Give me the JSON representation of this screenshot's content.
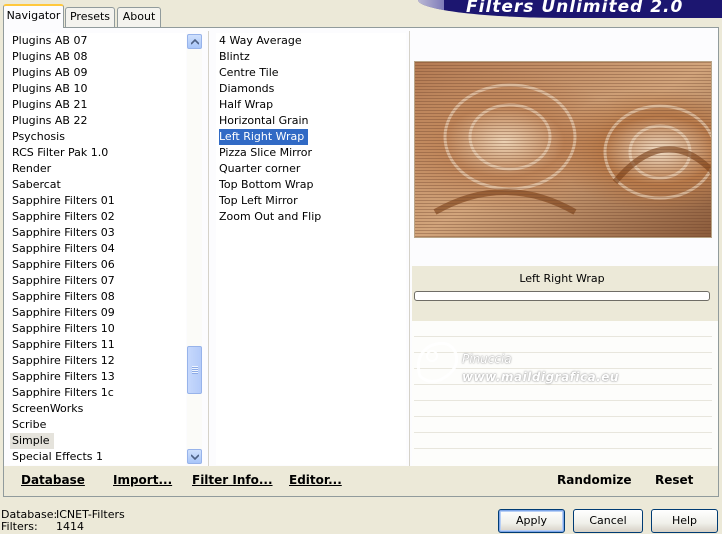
{
  "window": {
    "title": "Filters Unlimited 2.0"
  },
  "tabs": [
    {
      "label": "Navigator",
      "active": true
    },
    {
      "label": "Presets",
      "active": false
    },
    {
      "label": "About",
      "active": false
    }
  ],
  "categories": {
    "items": [
      "Plugins AB 07",
      "Plugins AB 08",
      "Plugins AB 09",
      "Plugins AB 10",
      "Plugins AB 21",
      "Plugins AB 22",
      "Psychosis",
      "RCS Filter Pak 1.0",
      "Render",
      "Sabercat",
      "Sapphire Filters 01",
      "Sapphire Filters 02",
      "Sapphire Filters 03",
      "Sapphire Filters 04",
      "Sapphire Filters 06",
      "Sapphire Filters 07",
      "Sapphire Filters 08",
      "Sapphire Filters 09",
      "Sapphire Filters 10",
      "Sapphire Filters 11",
      "Sapphire Filters 12",
      "Sapphire Filters 13",
      "Sapphire Filters 1c",
      "ScreenWorks",
      "Scribe",
      "Simple",
      "Special Effects 1"
    ],
    "selected": "Simple"
  },
  "filters": {
    "items": [
      "4 Way Average",
      "Blintz",
      "Centre Tile",
      "Diamonds",
      "Half Wrap",
      "Horizontal Grain",
      "Left Right Wrap",
      "Pizza Slice Mirror",
      "Quarter corner",
      "Top Bottom Wrap",
      "Top Left Mirror",
      "Zoom Out and Flip"
    ],
    "selected": "Left Right Wrap"
  },
  "preview": {
    "filter_name": "Left Right Wrap"
  },
  "watermark": {
    "name": "Pinuccia",
    "url": "www.maildigrafica.eu"
  },
  "actions": {
    "database": "Database",
    "import": "Import...",
    "filter_info": "Filter Info...",
    "editor": "Editor...",
    "randomize": "Randomize",
    "reset": "Reset"
  },
  "status": {
    "database_label": "Database:",
    "database_value": "ICNET-Filters",
    "filters_label": "Filters:",
    "filters_value": "1414"
  },
  "buttons": {
    "apply": "Apply",
    "cancel": "Cancel",
    "help": "Help"
  },
  "colors": {
    "selection": "#316ac5",
    "banner": "#1c1670",
    "background": "#ece9d8"
  }
}
